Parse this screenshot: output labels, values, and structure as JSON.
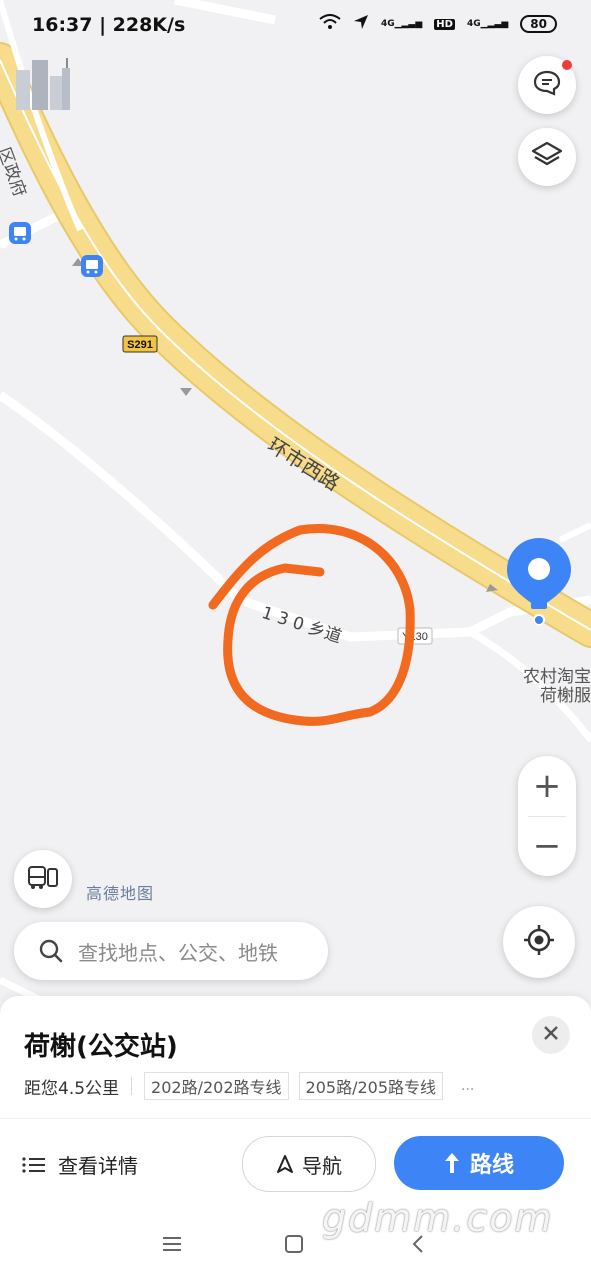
{
  "status_bar": {
    "time": "16:37 | 228K/s",
    "signal_1": "4G",
    "hd": "HD",
    "signal_2": "4G",
    "battery": "80"
  },
  "map": {
    "road_badge": "S291",
    "road_name_main": "环市西路",
    "road_name_village": "1 3 0 乡道",
    "road_code": "Y130",
    "poi_line1": "农村淘宝",
    "poi_line2": "荷榭服",
    "partial_label": "区政府",
    "logo": "高德地图",
    "colors": {
      "highway": "#f7dc8c",
      "accent": "#3d84f7",
      "annotation": "#f26a1f"
    }
  },
  "controls": {
    "feedback_icon": "message-icon",
    "layers_icon": "layers-icon",
    "zoom_in": "+",
    "zoom_out": "−",
    "locate_icon": "locate-icon"
  },
  "search": {
    "placeholder": "查找地点、公交、地铁"
  },
  "sheet": {
    "title": "荷榭(公交站)",
    "distance": "距您4.5公里",
    "routes": [
      "202路/202路专线",
      "205路/205路专线"
    ],
    "more": "...",
    "details_label": "查看详情",
    "navigate_label": "导航",
    "route_label": "路线"
  },
  "watermark": "gdmm.com"
}
